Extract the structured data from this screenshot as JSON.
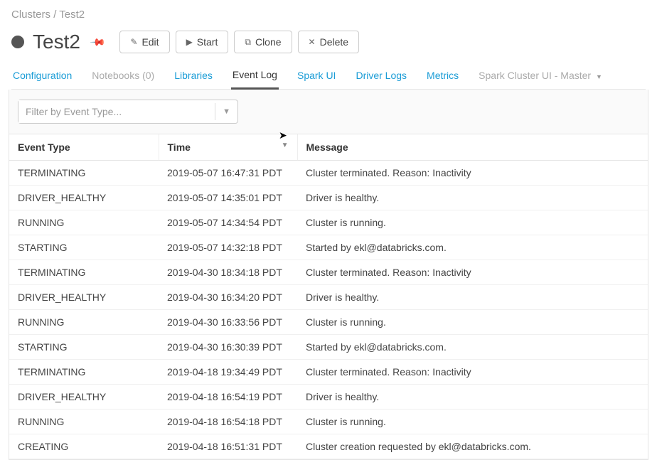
{
  "breadcrumb": {
    "root": "Clusters",
    "sep": "/",
    "leaf": "Test2"
  },
  "title": "Test2",
  "toolbar": {
    "edit": "Edit",
    "start": "Start",
    "clone": "Clone",
    "delete": "Delete"
  },
  "tabs": {
    "configuration": "Configuration",
    "notebooks": "Notebooks (0)",
    "libraries": "Libraries",
    "event_log": "Event Log",
    "spark_ui": "Spark UI",
    "driver_logs": "Driver Logs",
    "metrics": "Metrics",
    "spark_cluster_ui": "Spark Cluster UI - Master"
  },
  "filter": {
    "placeholder": "Filter by Event Type..."
  },
  "columns": {
    "event_type": "Event Type",
    "time": "Time",
    "message": "Message"
  },
  "events": [
    {
      "type": "TERMINATING",
      "time": "2019-05-07 16:47:31 PDT",
      "message": "Cluster terminated. Reason: Inactivity"
    },
    {
      "type": "DRIVER_HEALTHY",
      "time": "2019-05-07 14:35:01 PDT",
      "message": "Driver is healthy."
    },
    {
      "type": "RUNNING",
      "time": "2019-05-07 14:34:54 PDT",
      "message": "Cluster is running."
    },
    {
      "type": "STARTING",
      "time": "2019-05-07 14:32:18 PDT",
      "message": "Started by ekl@databricks.com."
    },
    {
      "type": "TERMINATING",
      "time": "2019-04-30 18:34:18 PDT",
      "message": "Cluster terminated. Reason: Inactivity"
    },
    {
      "type": "DRIVER_HEALTHY",
      "time": "2019-04-30 16:34:20 PDT",
      "message": "Driver is healthy."
    },
    {
      "type": "RUNNING",
      "time": "2019-04-30 16:33:56 PDT",
      "message": "Cluster is running."
    },
    {
      "type": "STARTING",
      "time": "2019-04-30 16:30:39 PDT",
      "message": "Started by ekl@databricks.com."
    },
    {
      "type": "TERMINATING",
      "time": "2019-04-18 19:34:49 PDT",
      "message": "Cluster terminated. Reason: Inactivity"
    },
    {
      "type": "DRIVER_HEALTHY",
      "time": "2019-04-18 16:54:19 PDT",
      "message": "Driver is healthy."
    },
    {
      "type": "RUNNING",
      "time": "2019-04-18 16:54:18 PDT",
      "message": "Cluster is running."
    },
    {
      "type": "CREATING",
      "time": "2019-04-18 16:51:31 PDT",
      "message": "Cluster creation requested by ekl@databricks.com."
    }
  ]
}
